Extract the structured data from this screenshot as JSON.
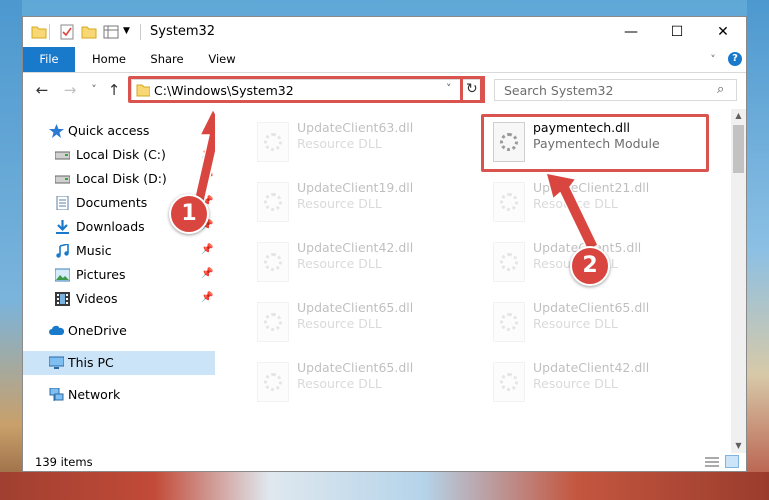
{
  "window": {
    "title": "System32",
    "controls": {
      "minimize": "—",
      "maximize": "☐",
      "close": "✕"
    }
  },
  "ribbon": {
    "tabs": [
      "File",
      "Home",
      "Share",
      "View"
    ],
    "expand_icon": "chevron-down-icon",
    "help_icon": "help-icon",
    "help_glyph": "?"
  },
  "address": {
    "back_glyph": "←",
    "forward_glyph": "→",
    "recent_glyph": "˅",
    "up_glyph": "↑",
    "path": "C:\\Windows\\System32",
    "dropdown_glyph": "˅",
    "refresh_glyph": "↻",
    "search_placeholder": "Search System32",
    "search_glyph": "⌕"
  },
  "nav": {
    "items": [
      {
        "label": "Quick access",
        "icon": "star-icon",
        "pinned": false
      },
      {
        "label": "Local Disk (C:)",
        "icon": "drive-icon",
        "pinned": true
      },
      {
        "label": "Local Disk (D:)",
        "icon": "drive-icon",
        "pinned": true
      },
      {
        "label": "Documents",
        "icon": "documents-icon",
        "pinned": true
      },
      {
        "label": "Downloads",
        "icon": "download-icon",
        "pinned": true
      },
      {
        "label": "Music",
        "icon": "music-icon",
        "pinned": true
      },
      {
        "label": "Pictures",
        "icon": "pictures-icon",
        "pinned": true
      },
      {
        "label": "Videos",
        "icon": "videos-icon",
        "pinned": true
      },
      {
        "label": "OneDrive",
        "icon": "onedrive-icon",
        "pinned": false
      },
      {
        "label": "This PC",
        "icon": "pc-icon",
        "pinned": false,
        "selected": true
      },
      {
        "label": "Network",
        "icon": "network-icon",
        "pinned": false
      }
    ],
    "pin_glyph": "📌"
  },
  "files": [
    {
      "name": "UpdateClient63.dll",
      "desc": "Resource DLL",
      "faded": true
    },
    {
      "name": "paymentech.dll",
      "desc": "Paymentech Module",
      "faded": false
    },
    {
      "name": "UpdateClient19.dll",
      "desc": "Resource DLL",
      "faded": true
    },
    {
      "name": "UpdateClient21.dll",
      "desc": "Resource DLL",
      "faded": true
    },
    {
      "name": "UpdateClient42.dll",
      "desc": "Resource DLL",
      "faded": true
    },
    {
      "name": "UpdateClient5.dll",
      "desc": "Resource DLL",
      "faded": true
    },
    {
      "name": "UpdateClient65.dll",
      "desc": "Resource DLL",
      "faded": true
    },
    {
      "name": "UpdateClient65.dll",
      "desc": "Resource DLL",
      "faded": true
    },
    {
      "name": "UpdateClient65.dll",
      "desc": "Resource DLL",
      "faded": true
    },
    {
      "name": "UpdateClient42.dll",
      "desc": "Resource DLL",
      "faded": true
    }
  ],
  "status": {
    "item_count": "139 items"
  },
  "callouts": [
    "1",
    "2"
  ],
  "colors": {
    "accent": "#1979ca",
    "highlight": "#d9534f",
    "callout": "#d9463f",
    "selected_nav": "#cce4f7"
  }
}
